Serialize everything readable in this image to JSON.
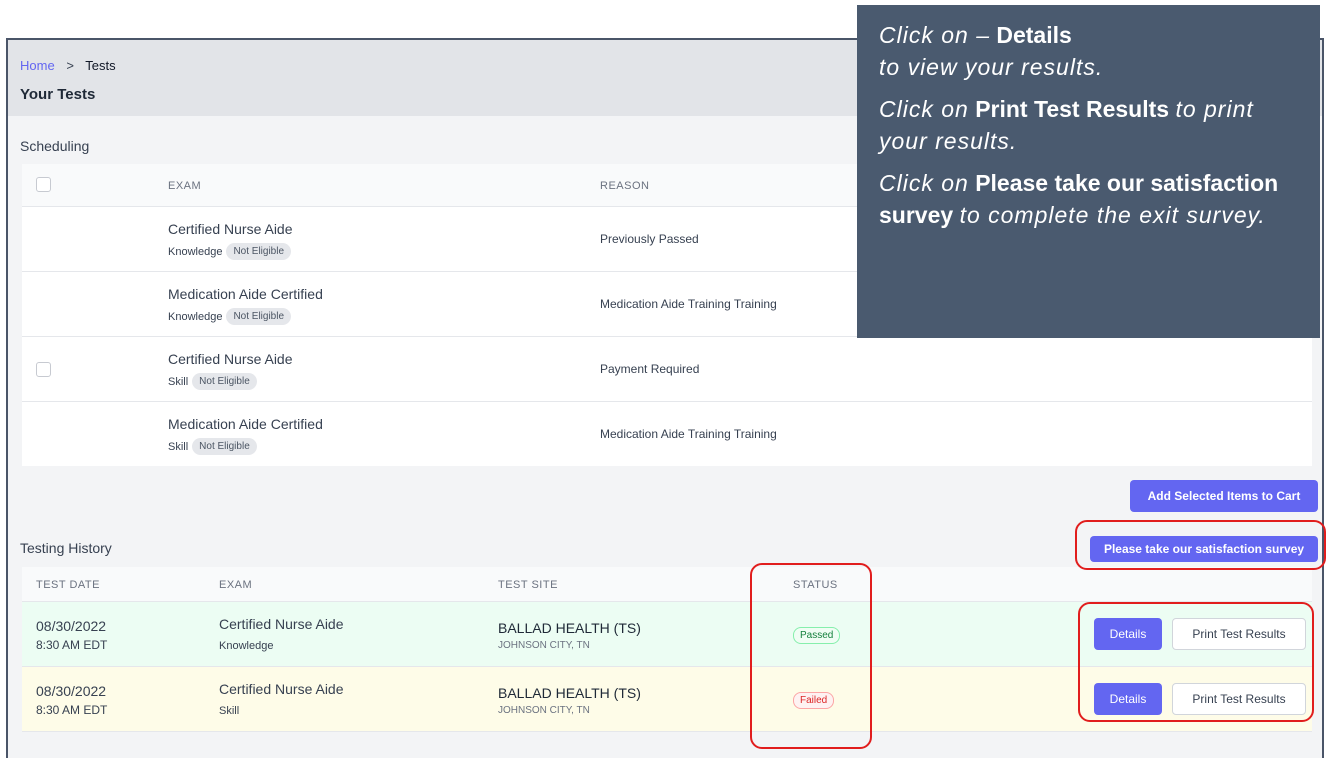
{
  "breadcrumb": {
    "home": "Home",
    "separator": ">",
    "current": "Tests"
  },
  "page_title": "Your Tests",
  "scheduling": {
    "label": "Scheduling",
    "columns": {
      "exam": "EXAM",
      "reason": "REASON"
    },
    "rows": [
      {
        "exam": "Certified Nurse Aide",
        "type": "Knowledge",
        "badge": "Not Eligible",
        "reason": "Previously Passed",
        "checkbox": false
      },
      {
        "exam": "Medication Aide Certified",
        "type": "Knowledge",
        "badge": "Not Eligible",
        "reason": "Medication Aide Training Training",
        "checkbox": false
      },
      {
        "exam": "Certified Nurse Aide",
        "type": "Skill",
        "badge": "Not Eligible",
        "reason": "Payment Required",
        "checkbox": true
      },
      {
        "exam": "Medication Aide Certified",
        "type": "Skill",
        "badge": "Not Eligible",
        "reason": "Medication Aide Training Training",
        "checkbox": false
      }
    ],
    "add_to_cart": "Add Selected Items to Cart"
  },
  "history": {
    "label": "Testing History",
    "survey_button": "Please take our satisfaction survey",
    "columns": {
      "date": "TEST DATE",
      "exam": "EXAM",
      "site": "TEST SITE",
      "status": "STATUS"
    },
    "rows": [
      {
        "date": "08/30/2022",
        "time": "8:30 AM EDT",
        "exam": "Certified Nurse Aide",
        "type": "Knowledge",
        "site": "BALLAD HEALTH (TS)",
        "city": "JOHNSON CITY, TN",
        "status": "Passed",
        "details": "Details",
        "print": "Print Test Results"
      },
      {
        "date": "08/30/2022",
        "time": "8:30 AM EDT",
        "exam": "Certified Nurse Aide",
        "type": "Skill",
        "site": "BALLAD HEALTH (TS)",
        "city": "JOHNSON CITY, TN",
        "status": "Failed",
        "details": "Details",
        "print": "Print Test Results"
      }
    ]
  },
  "callout": {
    "line1_italic": "Click on –",
    "line1_bold": "Details",
    "line1_tail": "to view your results.",
    "line2_italic": "Click on",
    "line2_bold": "Print Test Results",
    "line2_tail": "to print your results.",
    "line3_italic": "Click on",
    "line3_bold": "Please take our satisfaction survey",
    "line3_tail": "to complete the exit survey."
  },
  "colors": {
    "accent": "#6366f1",
    "callout_bg": "#4a5a6f",
    "highlight": "#e11d1d",
    "passed": "#15803d",
    "failed": "#dc2626"
  }
}
